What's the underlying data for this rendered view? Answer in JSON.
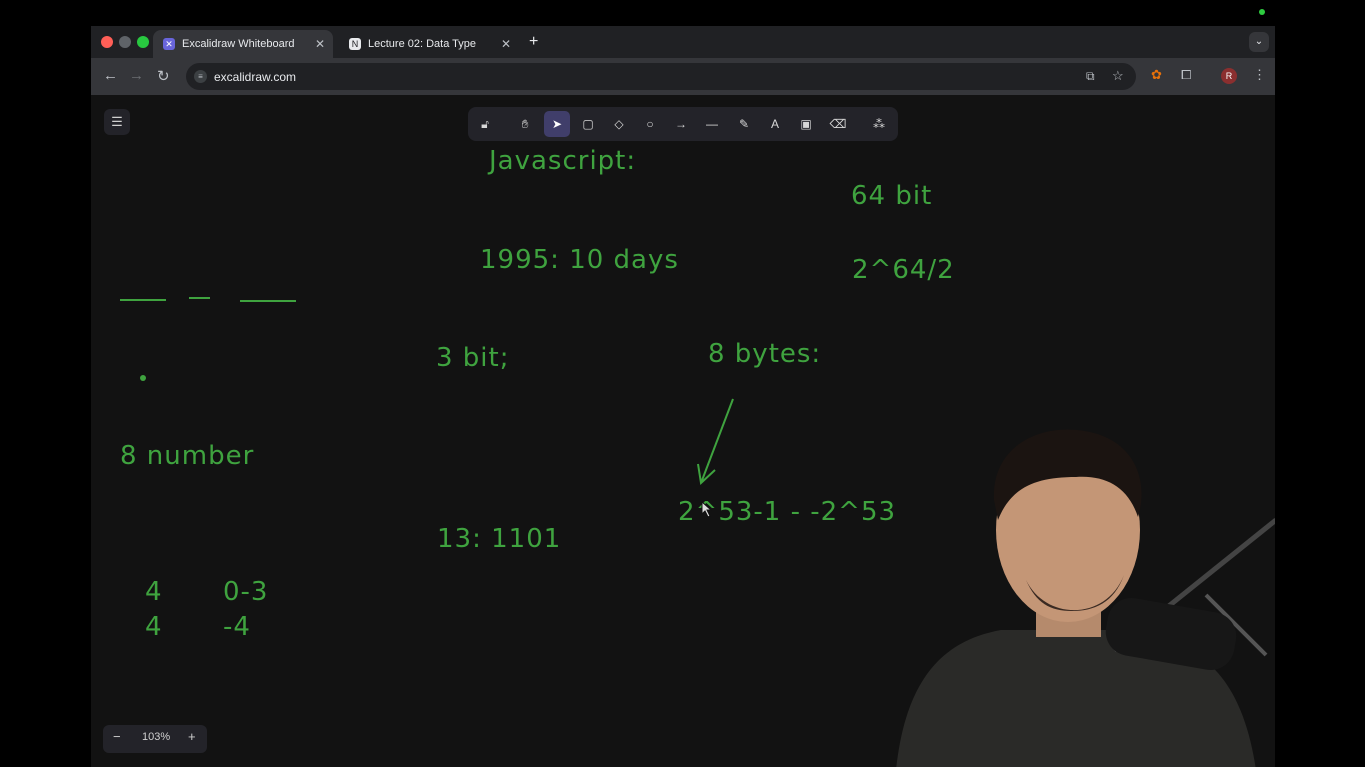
{
  "browser": {
    "tabs": [
      {
        "title": "Excalidraw Whiteboard",
        "active": true
      },
      {
        "title": "Lecture 02: Data Type",
        "active": false
      }
    ],
    "url": "excalidraw.com",
    "profile_initial": "R"
  },
  "excalidraw": {
    "zoom_label": "103%",
    "selected_tool": "selection"
  },
  "canvas_texts": {
    "javascript": "Javascript:",
    "bits64": "64 bit",
    "year": "1995: 10 days",
    "pow": "2^64/2",
    "bit3": "3 bit;",
    "bytes8": "8 bytes:",
    "number8": "8 number",
    "range": "2^53-1 - -2^53",
    "bin13": "13: 1101",
    "four1": "4",
    "four2": "4",
    "range03": "0-3",
    "neg4": "-4"
  },
  "colors": {
    "ink": "#3fa33f",
    "canvas_bg": "#121212",
    "selected_tool": "#403e6a"
  }
}
